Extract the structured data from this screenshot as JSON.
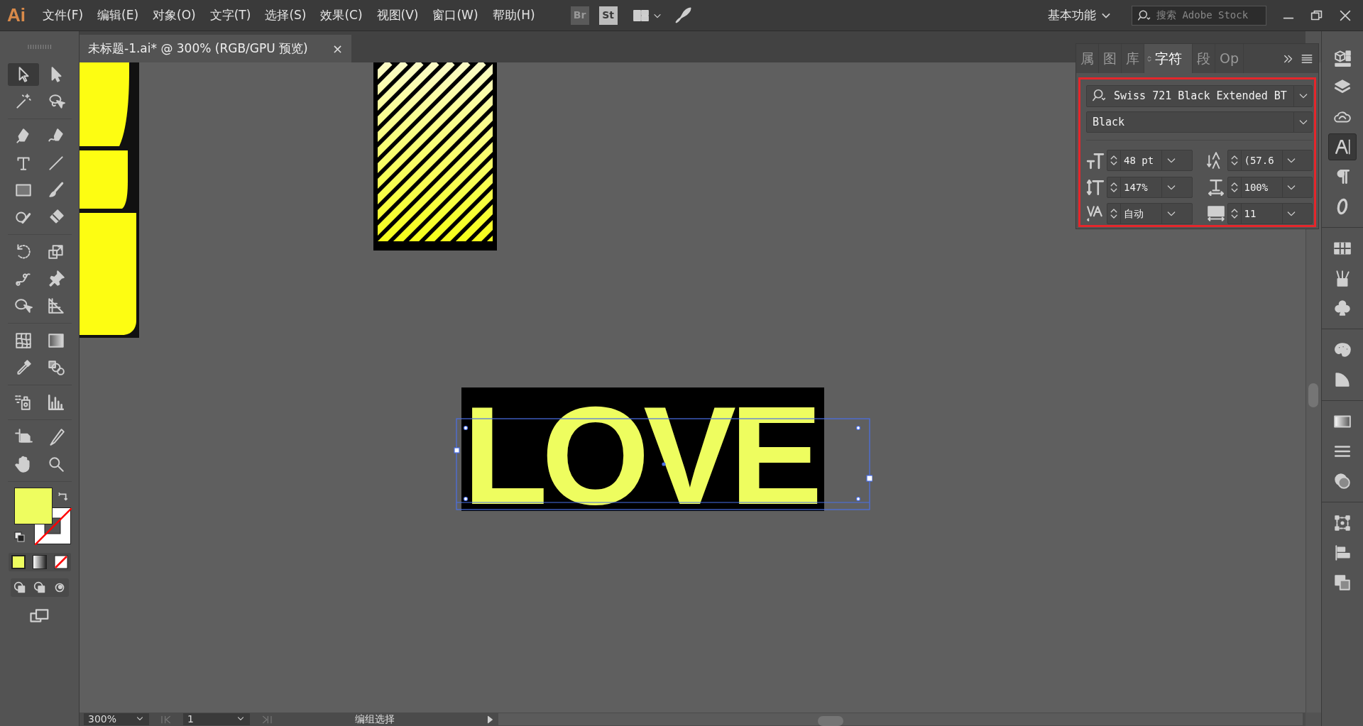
{
  "app": {
    "logo": "Ai"
  },
  "menu": [
    "文件(F)",
    "编辑(E)",
    "对象(O)",
    "文字(T)",
    "选择(S)",
    "效果(C)",
    "视图(V)",
    "窗口(W)",
    "帮助(H)"
  ],
  "bridge_buttons": [
    "Br",
    "St"
  ],
  "workspace": "基本功能",
  "search": {
    "placeholder": "搜索 Adobe Stock"
  },
  "document_tab": {
    "title": "未标题-1.ai* @ 300% (RGB/GPU 预览)",
    "close": "×"
  },
  "canvas": {
    "text": "LOVE"
  },
  "character_panel": {
    "tabs": [
      {
        "label": "属",
        "selected": false
      },
      {
        "label": "图",
        "selected": false
      },
      {
        "label": "库",
        "selected": false
      },
      {
        "label": "字符",
        "selected": true
      },
      {
        "label": "段",
        "selected": false
      },
      {
        "label": "Op",
        "selected": false
      }
    ],
    "font_family": "Swiss 721 Black Extended BT",
    "font_style": "Black",
    "fields": [
      {
        "kind": "font-size",
        "value": "48 pt"
      },
      {
        "kind": "leading",
        "value": "(57.6"
      },
      {
        "kind": "vertical-scale",
        "value": "147%"
      },
      {
        "kind": "horizontal-scale",
        "value": "100%"
      },
      {
        "kind": "kerning",
        "value": "自动"
      },
      {
        "kind": "tracking",
        "value": "11"
      }
    ]
  },
  "dock": [
    {
      "kind": "cube",
      "selected": false
    },
    {
      "kind": "layers",
      "selected": false
    },
    {
      "kind": "cloud",
      "selected": false
    },
    {
      "kind": "character",
      "selected": true
    },
    {
      "kind": "paragraph",
      "selected": false
    },
    {
      "kind": "opentype",
      "selected": false
    },
    {
      "kind": "swatches",
      "selected": false
    },
    {
      "kind": "brushes",
      "selected": false
    },
    {
      "kind": "symbols",
      "selected": false
    },
    {
      "kind": "palette",
      "selected": false
    },
    {
      "kind": "guide",
      "selected": false
    },
    {
      "kind": "gradient",
      "selected": false
    },
    {
      "kind": "stroke",
      "selected": false
    },
    {
      "kind": "transparency",
      "selected": false
    },
    {
      "kind": "transform",
      "selected": false
    },
    {
      "kind": "align",
      "selected": false
    },
    {
      "kind": "pathfinder",
      "selected": false
    }
  ],
  "status_bar": {
    "zoom": "300%",
    "artboard": "1",
    "tool": "编组选择"
  }
}
